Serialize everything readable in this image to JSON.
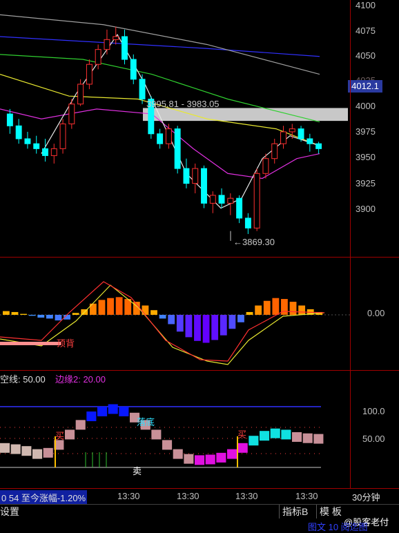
{
  "price_axis": [
    "4100",
    "4075",
    "4050",
    "4025",
    "4000",
    "3975",
    "3950",
    "3925",
    "3900"
  ],
  "current_price": "4012.1",
  "range_label": "3995.81 - 3983.05",
  "low_label": "3869.30",
  "macd_zero_label": "0.00",
  "macd_divergence": "顶背",
  "indicator3": {
    "line1_label": "空线: 50.00",
    "line2_label": "边缘2: 20.00",
    "tag_buy1": "买",
    "tag_buy2": "买",
    "tag_sell": "卖",
    "tag_drop": "落底",
    "level100": "100.0",
    "level50": "50.00"
  },
  "time_bar": {
    "info": "0 54 至今涨幅-1.20%",
    "times": [
      "13:30",
      "13:30",
      "13:30",
      "13:30",
      "13:30"
    ],
    "period": "30分钟"
  },
  "bottom_bar": {
    "left": "设置",
    "indicator_btn": "指标B",
    "template_btn": "模 板",
    "watermark": "@股客老付",
    "footer_text": "图文 10 阅迄图"
  },
  "colors": {
    "up": "#ff3030",
    "down": "#00ffff",
    "ma_white": "#e8e8e8",
    "ma_yellow": "#e8e830",
    "ma_magenta": "#e030e0",
    "ma_green": "#30d030",
    "ma_blue": "#3030ff",
    "ma_gray": "#a0a0a0"
  },
  "chart_data": {
    "type": "candlestick",
    "price_ylim": [
      3860,
      4100
    ],
    "candles_note": "approximate OHLC from visual",
    "candles": [
      [
        3990,
        3995,
        3970,
        3978
      ],
      [
        3978,
        3985,
        3960,
        3965
      ],
      [
        3965,
        3972,
        3955,
        3960
      ],
      [
        3960,
        3968,
        3950,
        3955
      ],
      [
        3955,
        3965,
        3942,
        3948
      ],
      [
        3948,
        3960,
        3940,
        3955
      ],
      [
        3955,
        3985,
        3950,
        3980
      ],
      [
        3980,
        4005,
        3975,
        4000
      ],
      [
        4000,
        4025,
        3998,
        4020
      ],
      [
        4020,
        4045,
        4015,
        4040
      ],
      [
        4040,
        4060,
        4035,
        4055
      ],
      [
        4055,
        4075,
        4050,
        4065
      ],
      [
        4065,
        4078,
        4060,
        4068
      ],
      [
        4068,
        4075,
        4040,
        4045
      ],
      [
        4045,
        4050,
        4020,
        4025
      ],
      [
        4025,
        4030,
        4000,
        4005
      ],
      [
        4005,
        4008,
        3965,
        3970
      ],
      [
        3970,
        3975,
        3955,
        3960
      ],
      [
        3960,
        3980,
        3955,
        3975
      ],
      [
        3975,
        3978,
        3930,
        3935
      ],
      [
        3935,
        3945,
        3915,
        3920
      ],
      [
        3920,
        3940,
        3910,
        3935
      ],
      [
        3935,
        3938,
        3895,
        3900
      ],
      [
        3900,
        3912,
        3890,
        3908
      ],
      [
        3908,
        3915,
        3895,
        3900
      ],
      [
        3900,
        3910,
        3888,
        3905
      ],
      [
        3905,
        3908,
        3880,
        3885
      ],
      [
        3885,
        3890,
        3869,
        3875
      ],
      [
        3875,
        3935,
        3872,
        3930
      ],
      [
        3930,
        3950,
        3925,
        3945
      ],
      [
        3945,
        3965,
        3940,
        3960
      ],
      [
        3960,
        3978,
        3955,
        3972
      ],
      [
        3972,
        3980,
        3965,
        3975
      ],
      [
        3975,
        3978,
        3962,
        3965
      ],
      [
        3965,
        3970,
        3952,
        3960
      ],
      [
        3960,
        3962,
        3950,
        3955
      ]
    ],
    "macd_hist": [
      4,
      3,
      1,
      -1,
      -3,
      -4,
      -6,
      -5,
      2,
      6,
      12,
      16,
      18,
      19,
      17,
      14,
      10,
      5,
      -4,
      -10,
      -18,
      -24,
      -28,
      -30,
      -27,
      -22,
      -15,
      -8,
      3,
      10,
      15,
      18,
      17,
      14,
      10,
      6,
      3
    ],
    "indicator3_bars": [
      40,
      38,
      35,
      30,
      32,
      45,
      62,
      78,
      92,
      100,
      104,
      100,
      90,
      78,
      62,
      45,
      30,
      22,
      20,
      21,
      24,
      30,
      40,
      52,
      60,
      64,
      62,
      58,
      56,
      55
    ]
  }
}
